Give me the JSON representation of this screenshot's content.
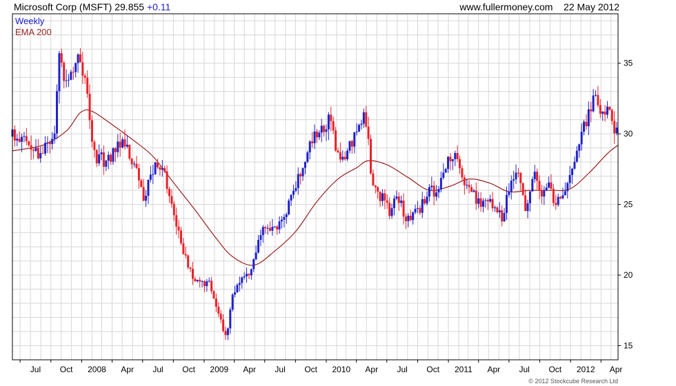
{
  "header": {
    "symbol": "Microsoft Corp (MSFT)",
    "price": "29.855",
    "change": "+0.11",
    "site": "www.fullermoney.com",
    "date": "22 May 2012"
  },
  "credit": "© 2012 Stockcube Research Ltd",
  "colors": {
    "up": "#1f22c8",
    "down": "#e8222a",
    "ema": "#9a1f1f",
    "grid": "#d6d6d6",
    "frame": "#000000"
  },
  "chart_data": {
    "type": "line",
    "legend": {
      "position": "top-left",
      "items": [
        {
          "name": "Weekly",
          "color": "#1f22c8"
        },
        {
          "name": "EMA 200",
          "color": "#9a1f1f"
        }
      ]
    },
    "ylim": [
      14,
      38.5
    ],
    "y_ticks": [
      15,
      20,
      25,
      30,
      35
    ],
    "y_grid_step": 1,
    "x_ticks": [
      "Jul",
      "Oct",
      "2008",
      "Apr",
      "Jul",
      "Oct",
      "2009",
      "Apr",
      "Jul",
      "Oct",
      "2010",
      "Apr",
      "Jul",
      "Oct",
      "2011",
      "Apr",
      "Jul",
      "Oct",
      "2012",
      "Apr"
    ],
    "x_start": "2007-06-08",
    "x_end": "2012-05-22",
    "grid": true,
    "series": [
      {
        "name": "Weekly",
        "kind": "price-bars",
        "anchors": [
          [
            "2007-06-08",
            29.8
          ],
          [
            "2007-07-13",
            29.6
          ],
          [
            "2007-08-10",
            28.7
          ],
          [
            "2007-09-07",
            28.7
          ],
          [
            "2007-10-12",
            30.2
          ],
          [
            "2007-10-26",
            35.5
          ],
          [
            "2007-11-09",
            34.2
          ],
          [
            "2007-12-07",
            34.2
          ],
          [
            "2007-12-28",
            35.5
          ],
          [
            "2008-01-18",
            32.5
          ],
          [
            "2008-02-08",
            28.5
          ],
          [
            "2008-03-14",
            28.0
          ],
          [
            "2008-04-11",
            29.0
          ],
          [
            "2008-05-02",
            29.5
          ],
          [
            "2008-06-06",
            28.0
          ],
          [
            "2008-07-04",
            25.6
          ],
          [
            "2008-08-08",
            27.5
          ],
          [
            "2008-09-05",
            27.0
          ],
          [
            "2008-10-10",
            23.5
          ],
          [
            "2008-11-14",
            20.5
          ],
          [
            "2008-12-12",
            19.5
          ],
          [
            "2009-01-16",
            19.5
          ],
          [
            "2009-02-13",
            17.5
          ],
          [
            "2009-03-06",
            15.5
          ],
          [
            "2009-03-27",
            18.5
          ],
          [
            "2009-04-24",
            19.5
          ],
          [
            "2009-05-22",
            20.5
          ],
          [
            "2009-06-26",
            23.5
          ],
          [
            "2009-08-07",
            23.5
          ],
          [
            "2009-09-18",
            25.3
          ],
          [
            "2009-10-23",
            28.0
          ],
          [
            "2009-11-20",
            29.5
          ],
          [
            "2009-12-25",
            30.5
          ],
          [
            "2010-01-15",
            31.0
          ],
          [
            "2010-02-05",
            28.3
          ],
          [
            "2010-03-05",
            28.7
          ],
          [
            "2010-04-16",
            31.0
          ],
          [
            "2010-04-30",
            31.0
          ],
          [
            "2010-05-21",
            26.0
          ],
          [
            "2010-06-18",
            25.5
          ],
          [
            "2010-07-09",
            24.5
          ],
          [
            "2010-08-06",
            25.5
          ],
          [
            "2010-08-27",
            24.0
          ],
          [
            "2010-09-24",
            24.5
          ],
          [
            "2010-10-15",
            25.0
          ],
          [
            "2010-11-05",
            26.5
          ],
          [
            "2010-11-26",
            25.5
          ],
          [
            "2010-12-24",
            28.0
          ],
          [
            "2011-01-14",
            28.5
          ],
          [
            "2011-02-04",
            27.5
          ],
          [
            "2011-03-04",
            26.0
          ],
          [
            "2011-04-08",
            25.0
          ],
          [
            "2011-05-06",
            25.0
          ],
          [
            "2011-06-10",
            24.0
          ],
          [
            "2011-07-08",
            26.5
          ],
          [
            "2011-07-29",
            27.0
          ],
          [
            "2011-08-19",
            24.5
          ],
          [
            "2011-09-16",
            27.0
          ],
          [
            "2011-10-07",
            25.5
          ],
          [
            "2011-10-28",
            26.5
          ],
          [
            "2011-11-18",
            25.0
          ],
          [
            "2011-12-16",
            25.8
          ],
          [
            "2012-01-13",
            28.5
          ],
          [
            "2012-02-03",
            30.0
          ],
          [
            "2012-02-24",
            31.5
          ],
          [
            "2012-03-16",
            32.5
          ],
          [
            "2012-04-06",
            31.5
          ],
          [
            "2012-04-27",
            32.0
          ],
          [
            "2012-05-11",
            30.5
          ],
          [
            "2012-05-22",
            29.855
          ]
        ]
      },
      {
        "name": "EMA 200",
        "kind": "line",
        "points": [
          [
            "2007-06-08",
            28.8
          ],
          [
            "2007-09-07",
            29.2
          ],
          [
            "2007-11-16",
            30.2
          ],
          [
            "2007-12-28",
            31.5
          ],
          [
            "2008-02-01",
            31.6
          ],
          [
            "2008-04-04",
            30.6
          ],
          [
            "2008-06-06",
            29.5
          ],
          [
            "2008-08-01",
            28.4
          ],
          [
            "2008-10-03",
            26.5
          ],
          [
            "2008-12-05",
            24.6
          ],
          [
            "2009-02-06",
            22.6
          ],
          [
            "2009-03-27",
            21.3
          ],
          [
            "2009-05-29",
            20.7
          ],
          [
            "2009-07-31",
            21.7
          ],
          [
            "2009-10-02",
            23.1
          ],
          [
            "2009-12-04",
            25.2
          ],
          [
            "2010-02-05",
            26.8
          ],
          [
            "2010-04-02",
            27.6
          ],
          [
            "2010-05-07",
            28.1
          ],
          [
            "2010-07-02",
            27.8
          ],
          [
            "2010-09-03",
            26.9
          ],
          [
            "2010-11-05",
            26.0
          ],
          [
            "2011-01-07",
            26.3
          ],
          [
            "2011-03-04",
            26.8
          ],
          [
            "2011-05-06",
            26.5
          ],
          [
            "2011-07-01",
            25.9
          ],
          [
            "2011-09-02",
            26.0
          ],
          [
            "2011-11-04",
            26.0
          ],
          [
            "2011-12-30",
            26.1
          ],
          [
            "2012-02-24",
            27.2
          ],
          [
            "2012-04-20",
            28.6
          ],
          [
            "2012-05-22",
            29.2
          ]
        ]
      }
    ]
  }
}
